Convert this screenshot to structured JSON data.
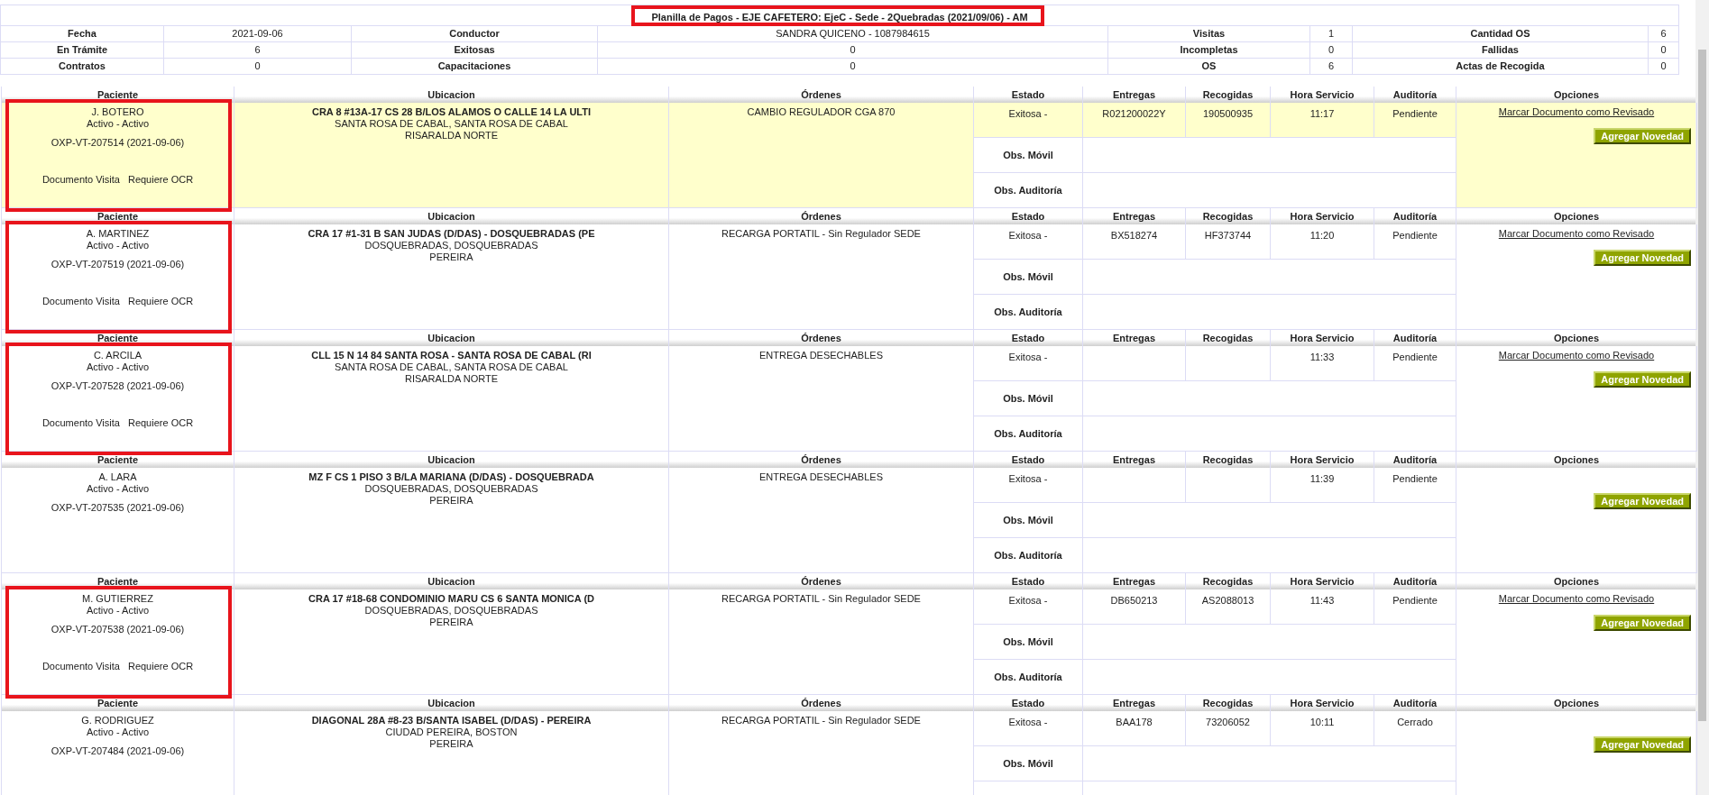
{
  "summary": {
    "title": "Planilla de Pagos - EJE CAFETERO: EjeC - Sede - 2Quebradas (2021/09/06) - AM",
    "title_annotated": true,
    "rows": [
      [
        {
          "label": "Fecha",
          "value": "2021-09-06"
        },
        {
          "label": "Conductor",
          "value": "SANDRA QUICENO - 1087984615"
        },
        {
          "label": "Visitas",
          "value": "1"
        },
        {
          "label": "Cantidad OS",
          "value": "6"
        }
      ],
      [
        {
          "label": "En Trámite",
          "value": "6"
        },
        {
          "label": "Exitosas",
          "value": "0"
        },
        {
          "label": "Incompletas",
          "value": "0"
        },
        {
          "label": "Fallidas",
          "value": "0"
        }
      ],
      [
        {
          "label": "Contratos",
          "value": "0"
        },
        {
          "label": "Capacitaciones",
          "value": "0"
        },
        {
          "label": "OS",
          "value": "6"
        },
        {
          "label": "Actas de Recogida",
          "value": "0"
        }
      ]
    ]
  },
  "records": [
    {
      "headers": [
        "Paciente",
        "Ubicacion",
        "Órdenes",
        "Estado",
        "Entregas",
        "Recogidas",
        "Hora Servicio",
        "Auditoría",
        "Opciones"
      ],
      "selected": true,
      "annotated": true,
      "name": "J. BOTERO",
      "status": "Activo - Activo",
      "code": "OXP-VT-207514 (2021-09-06)",
      "doc_notes": [
        "Documento Visita",
        "Requiere OCR"
      ],
      "address": "CRA 8 #13A-17 CS 28 B/LOS ALAMOS O CALLE 14 LA ULTI",
      "city": "SANTA ROSA DE CABAL, SANTA ROSA DE CABAL",
      "region": "RISARALDA NORTE",
      "orders": "CAMBIO REGULADOR CGA 870",
      "estado": "Exitosa -",
      "entregas": "R021200022Y",
      "recogidas": "190500935",
      "hora": "11:17",
      "auditoria": "Pendiente",
      "mark_link": "Marcar Documento como Revisado",
      "button": "Agregar Novedad",
      "obs": [
        "Obs. Móvil",
        "Obs. Auditoría"
      ]
    },
    {
      "headers": [
        "Paciente",
        "Ubicacion",
        "Órdenes",
        "Estado",
        "Entregas",
        "Recogidas",
        "Hora Servicio",
        "Auditoría",
        "Opciones"
      ],
      "selected": false,
      "annotated": true,
      "name": "A. MARTINEZ",
      "status": "Activo - Activo",
      "code": "OXP-VT-207519 (2021-09-06)",
      "doc_notes": [
        "Documento Visita",
        "Requiere OCR"
      ],
      "address": "CRA 17 #1-31 B SAN JUDAS (D/DAS) - DOSQUEBRADAS (PE",
      "city": "DOSQUEBRADAS, DOSQUEBRADAS",
      "region": "PEREIRA",
      "orders": "RECARGA PORTATIL - Sin Regulador SEDE",
      "estado": "Exitosa -",
      "entregas": "BX518274",
      "recogidas": "HF373744",
      "hora": "11:20",
      "auditoria": "Pendiente",
      "mark_link": "Marcar Documento como Revisado",
      "button": "Agregar Novedad",
      "obs": [
        "Obs. Móvil",
        "Obs. Auditoría"
      ]
    },
    {
      "headers": [
        "Paciente",
        "Ubicacion",
        "Órdenes",
        "Estado",
        "Entregas",
        "Recogidas",
        "Hora Servicio",
        "Auditoría",
        "Opciones"
      ],
      "selected": false,
      "annotated": true,
      "name": "C. ARCILA",
      "status": "Activo - Activo",
      "code": "OXP-VT-207528 (2021-09-06)",
      "doc_notes": [
        "Documento Visita",
        "Requiere OCR"
      ],
      "address": "CLL 15 N 14 84 SANTA ROSA - SANTA ROSA DE CABAL (RI",
      "city": "SANTA ROSA DE CABAL, SANTA ROSA DE CABAL",
      "region": "RISARALDA NORTE",
      "orders": "ENTREGA DESECHABLES",
      "estado": "Exitosa -",
      "hora": "11:33",
      "auditoria": "Pendiente",
      "mark_link": "Marcar Documento como Revisado",
      "button": "Agregar Novedad",
      "obs": [
        "Obs. Móvil",
        "Obs. Auditoría"
      ]
    },
    {
      "headers": [
        "Paciente",
        "Ubicacion",
        "Órdenes",
        "Estado",
        "Entregas",
        "Recogidas",
        "Hora Servicio",
        "Auditoría",
        "Opciones"
      ],
      "selected": false,
      "annotated": false,
      "name": "A. LARA",
      "status": "Activo - Activo",
      "code": "OXP-VT-207535 (2021-09-06)",
      "address": "MZ F CS 1 PISO 3 B/LA MARIANA (D/DAS) - DOSQUEBRADA",
      "city": "DOSQUEBRADAS, DOSQUEBRADAS",
      "region": "PEREIRA",
      "orders": "ENTREGA DESECHABLES",
      "estado": "Exitosa -",
      "hora": "11:39",
      "auditoria": "Pendiente",
      "button": "Agregar Novedad",
      "obs": [
        "Obs. Móvil",
        "Obs. Auditoría"
      ]
    },
    {
      "headers": [
        "Paciente",
        "Ubicacion",
        "Órdenes",
        "Estado",
        "Entregas",
        "Recogidas",
        "Hora Servicio",
        "Auditoría",
        "Opciones"
      ],
      "selected": false,
      "annotated": true,
      "name": "M. GUTIERREZ",
      "status": "Activo - Activo",
      "code": "OXP-VT-207538 (2021-09-06)",
      "doc_notes": [
        "Documento Visita",
        "Requiere OCR"
      ],
      "address": "CRA 17 #18-68 CONDOMINIO MARU CS 6 SANTA MONICA (D",
      "city": "DOSQUEBRADAS, DOSQUEBRADAS",
      "region": "PEREIRA",
      "orders": "RECARGA PORTATIL - Sin Regulador SEDE",
      "estado": "Exitosa -",
      "entregas": "DB650213",
      "recogidas": "AS2088013",
      "hora": "11:43",
      "auditoria": "Pendiente",
      "mark_link": "Marcar Documento como Revisado",
      "button": "Agregar Novedad",
      "obs": [
        "Obs. Móvil",
        "Obs. Auditoría"
      ]
    },
    {
      "headers": [
        "Paciente",
        "Ubicacion",
        "Órdenes",
        "Estado",
        "Entregas",
        "Recogidas",
        "Hora Servicio",
        "Auditoría",
        "Opciones"
      ],
      "selected": false,
      "annotated": false,
      "name": "G. RODRIGUEZ",
      "status": "Activo - Activo",
      "code": "OXP-VT-207484 (2021-09-06)",
      "address": "DIAGONAL 28A #8-23 B/SANTA ISABEL (D/DAS) - PEREIRA",
      "city": "CIUDAD PEREIRA, BOSTON",
      "region": "PEREIRA",
      "orders": "RECARGA PORTATIL - Sin Regulador SEDE",
      "estado": "Exitosa -",
      "entregas": "BAA178",
      "recogidas": "73206052",
      "hora": "10:11",
      "auditoria": "Cerrado",
      "button": "Agregar Novedad",
      "obs": [
        "Obs. Móvil"
      ]
    }
  ]
}
